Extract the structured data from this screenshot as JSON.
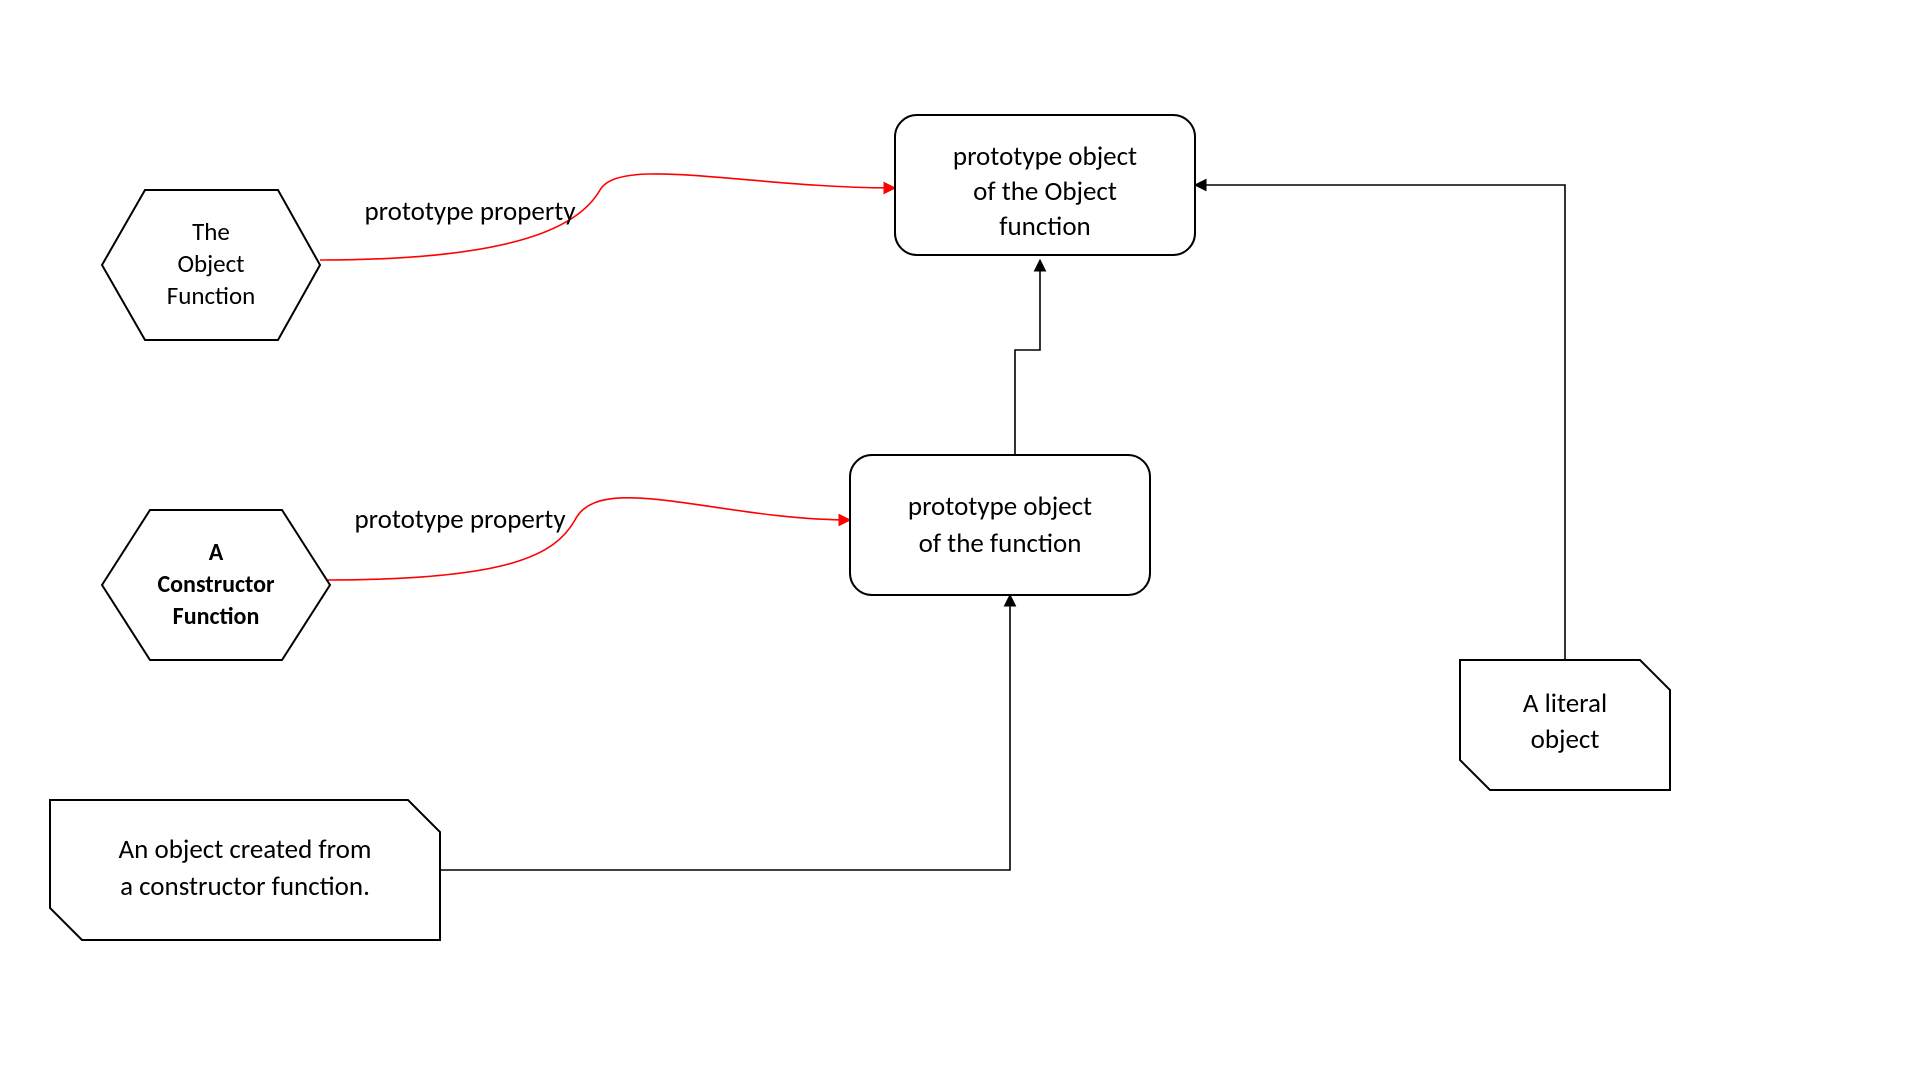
{
  "nodes": {
    "object_function": {
      "line1": "The",
      "line2": "Object",
      "line3": "Function"
    },
    "constructor_function": {
      "line1": "A",
      "line2": "Constructor",
      "line3": "Function"
    },
    "proto_object_fn": {
      "line1": "prototype object",
      "line2": "of the Object",
      "line3": "function"
    },
    "proto_fn": {
      "line1": "prototype object",
      "line2": "of the function"
    },
    "ctor_instance": {
      "line1": "An object created from",
      "line2": "a constructor function."
    },
    "literal": {
      "line1": "A literal",
      "line2": "object"
    }
  },
  "edges": {
    "proto_prop_1": "prototype property",
    "proto_prop_2": "prototype property"
  },
  "colors": {
    "red": "#ff0000",
    "black": "#000000"
  }
}
